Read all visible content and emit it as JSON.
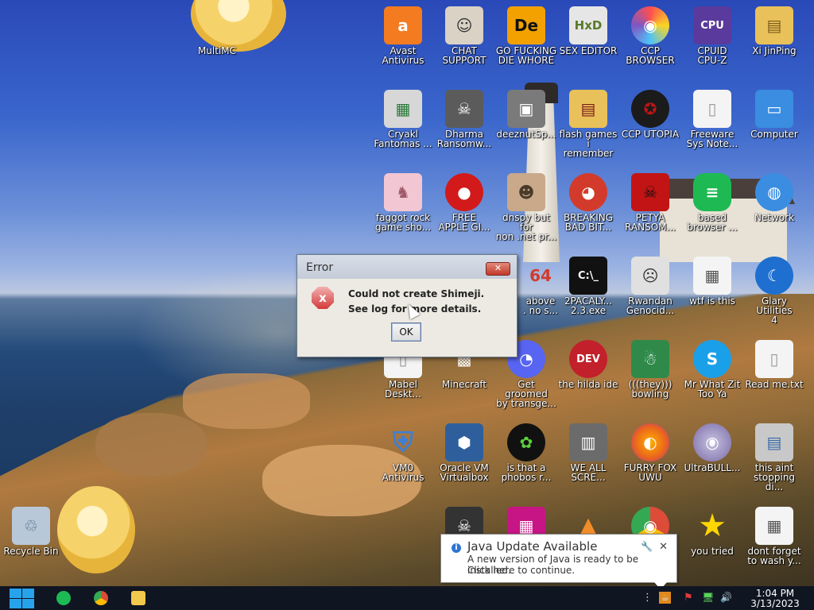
{
  "desktop_icons": [
    {
      "label": "MultiMC",
      "color": "#6aa84f",
      "glyph": ""
    },
    {
      "label": "Avast\nAntivirus",
      "color": "#f47b20",
      "glyph": "a"
    },
    {
      "label": "CHAT\nSUPPORT",
      "color": "#d9d2c5",
      "glyph": "☺"
    },
    {
      "label": "GO FUCKING\nDIE WHORE",
      "color": "#f2a100",
      "glyph": "De"
    },
    {
      "label": "SEX EDITOR",
      "color": "#e6e6e6",
      "glyph": "HxD"
    },
    {
      "label": "CCP\nBROWSER",
      "color": "#4f8ff2",
      "glyph": "◉"
    },
    {
      "label": "CPUID\nCPU-Z",
      "color": "#5a3a9c",
      "glyph": "CPU"
    },
    {
      "label": "Xi JinPing",
      "color": "#e9c15a",
      "glyph": "▤"
    },
    {
      "label": "Cryakl\nFantomas ...",
      "color": "#d7d7d7",
      "glyph": "▦"
    },
    {
      "label": "Dharma\nRansomw...",
      "color": "#5b5b5b",
      "glyph": "☠"
    },
    {
      "label": "deeznutSp...",
      "color": "#7a7a7a",
      "glyph": "▣"
    },
    {
      "label": "flash games i\nremember",
      "color": "#e9c15a",
      "glyph": "▤"
    },
    {
      "label": "CCP UTOPIA",
      "color": "#1b1b1b",
      "glyph": "✪"
    },
    {
      "label": "Freeware\nSys Note...",
      "color": "#f4f4f4",
      "glyph": "▯"
    },
    {
      "label": "Computer",
      "color": "#3a8de0",
      "glyph": "▭"
    },
    {
      "label": "faggot rock\ngame sho...",
      "color": "#f3c6d3",
      "glyph": "♞"
    },
    {
      "label": "FREE\nAPPLE GI...",
      "color": "#d21a1a",
      "glyph": "●"
    },
    {
      "label": "dnspy but for\nnon .net pr...",
      "color": "#c9a98a",
      "glyph": "☻"
    },
    {
      "label": "BREAKING\nBAD BIT...",
      "color": "#d23b2b",
      "glyph": "◕"
    },
    {
      "label": "PETYA\nRANSOM...",
      "color": "#c21414",
      "glyph": "☠"
    },
    {
      "label": "based\nbrowser ...",
      "color": "#1fb954",
      "glyph": "≡"
    },
    {
      "label": "Network",
      "color": "#3a8de0",
      "glyph": "◍"
    },
    {
      "label": "above\n. no s...",
      "color": "#8a3a2a",
      "glyph": "64"
    },
    {
      "label": "2PACALY...\n2.3.exe",
      "color": "#111111",
      "glyph": "C:\\_"
    },
    {
      "label": "Rwandan\nGenocid...",
      "color": "#e0e0e0",
      "glyph": "☹"
    },
    {
      "label": "wtf is this",
      "color": "#f4f4f4",
      "glyph": "▦"
    },
    {
      "label": "Glary Utilities\n4",
      "color": "#1e6fd0",
      "glyph": "☾"
    },
    {
      "label": "Mabel\nDeskt...",
      "color": "#f4f4f4",
      "glyph": "▯"
    },
    {
      "label": "Minecraft",
      "color": "#5a8a3a",
      "glyph": "▩"
    },
    {
      "label": "Get groomed\nby transge...",
      "color": "#5865f2",
      "glyph": "◔"
    },
    {
      "label": "the hilda ide",
      "color": "#c2202a",
      "glyph": "DEV"
    },
    {
      "label": "(((they)))\nbowling",
      "color": "#2f8a4a",
      "glyph": "☃"
    },
    {
      "label": "Mr What Zit\nToo Ya",
      "color": "#1aa0e8",
      "glyph": "S"
    },
    {
      "label": "Read me.txt",
      "color": "#f4f4f4",
      "glyph": "▯"
    },
    {
      "label": "VM0\nAntivirus",
      "color": "#3d7fd6",
      "glyph": "⛨"
    },
    {
      "label": "Oracle VM\nVirtualbox",
      "color": "#2e5f9c",
      "glyph": "⬢"
    },
    {
      "label": "is that a\nphobos r...",
      "color": "#111111",
      "glyph": "✿"
    },
    {
      "label": "WE ALL\nSCRE...",
      "color": "#6b6b6b",
      "glyph": "▥"
    },
    {
      "label": "FURRY FOX\nUWU",
      "color": "#e8621e",
      "glyph": "◐"
    },
    {
      "label": "UltraBULL...",
      "color": "#bdb7d8",
      "glyph": "◎"
    },
    {
      "label": "this aint\nstopping di...",
      "color": "#c8c8c8",
      "glyph": "▤"
    },
    {
      "label": "Recycle Bin",
      "color": "#b9c8d8",
      "glyph": "♲"
    },
    {
      "label": "",
      "color": "#333333",
      "glyph": "☠"
    },
    {
      "label": "",
      "color": "#c71585",
      "glyph": "▦"
    },
    {
      "label": "",
      "color": "#f28c28",
      "glyph": "▲"
    },
    {
      "label": "",
      "color": "#dd4b39",
      "glyph": "◉"
    },
    {
      "label": "you tried",
      "color": "#ffd700",
      "glyph": "★"
    },
    {
      "label": "dont forget\nto wash y...",
      "color": "#f4f4f4",
      "glyph": "▦"
    }
  ],
  "dialog": {
    "title": "Error",
    "close_glyph": "✕",
    "error_glyph": "x",
    "message_line1": "Could not create Shimeji.",
    "message_line2": "See log for more details.",
    "ok_label": "OK"
  },
  "java_notification": {
    "title": "Java Update Available",
    "line1": "A new version of Java is ready to be installed.",
    "line2": "Click here to continue.",
    "info_glyph": "i",
    "wrench_glyph": "🔧",
    "close_glyph": "✕"
  },
  "taskbar": {
    "apps": [
      {
        "name": "spotify",
        "color": "#1db954"
      },
      {
        "name": "chrome",
        "color": "#e94235"
      },
      {
        "name": "file-explorer",
        "color": "#f2c94c"
      }
    ],
    "tray": {
      "overflow_glyph": "⋮",
      "java_glyph": "☕",
      "flag_glyph": "⚑",
      "network_glyph": "🖥",
      "volume_glyph": "🔊"
    },
    "clock_time": "1:04 PM",
    "clock_date": "3/13/2023"
  },
  "colors": {
    "accent": "#27a3ec",
    "taskbar": "#101522",
    "dialog_bg": "#eceae2"
  }
}
